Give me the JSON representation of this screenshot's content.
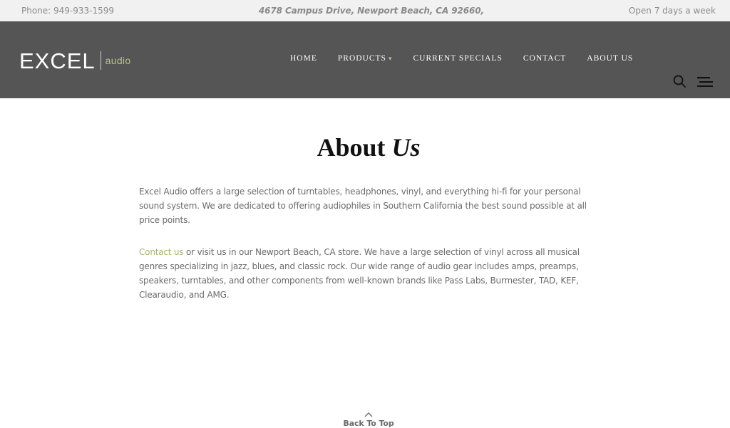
{
  "topbar": {
    "phone": "Phone: 949-933-1599",
    "address": "4678 Campus Drive, Newport Beach, CA 92660,",
    "hours": "Open 7 days a week"
  },
  "header": {
    "logo_main": "EXCEL",
    "logo_sub": "audio",
    "nav": [
      {
        "label": "HOME"
      },
      {
        "label": "PRODUCTS"
      },
      {
        "label": "CURRENT SPECIALS"
      },
      {
        "label": "CONTACT"
      },
      {
        "label": "ABOUT US"
      }
    ]
  },
  "page": {
    "title_part1": "About",
    "title_part2": "Us",
    "para1": "Excel Audio offers a large selection of turntables, headphones, vinyl, and everything hi-fi for your personal sound system. We are dedicated to offering audiophiles in Southern California the best sound possible at all price points.",
    "para2_link": "Contact us",
    "para2_rest": " or visit us in our Newport Beach, CA store. We have a large selection of vinyl across all musical genres specializing in jazz, blues, and classic rock. Our wide range of audio gear includes amps, preamps, speakers, turntables, and other components from well-known brands like Pass Labs, Burmester, TAD, KEF, Clearaudio, and AMG.",
    "back_to_top": "Back To Top"
  },
  "icons": {
    "search": "search-icon",
    "menu": "hamburger-menu-icon",
    "caret": "chevron-down-icon",
    "back_to_top": "chevron-up-icon"
  },
  "colors": {
    "header_bg": "#555555",
    "accent": "#b7c08f",
    "link": "#a8b366",
    "topbar_bg": "#f1f1f1"
  }
}
